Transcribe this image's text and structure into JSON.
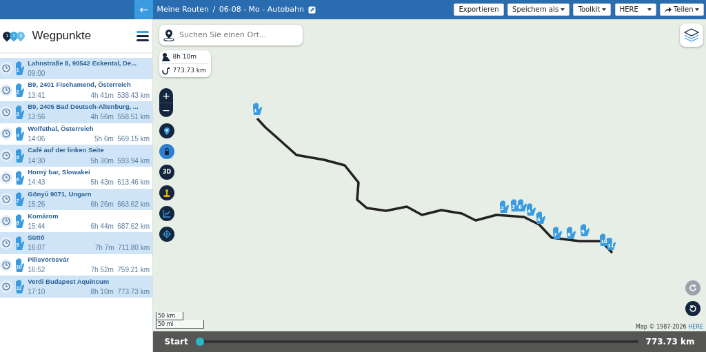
{
  "header": {
    "back": "←",
    "breadcrumb": "Meine Routen",
    "separator": "/",
    "route_name": "06-08 - Mo - Autobahn",
    "buttons": [
      {
        "label": "Exportieren",
        "kind": "plain"
      },
      {
        "label": "Speichern als",
        "kind": "dropdown"
      },
      {
        "label": "Toolkit",
        "kind": "dropdown"
      },
      {
        "label": "HERE",
        "kind": "select"
      },
      {
        "label": "Teilen",
        "kind": "share"
      }
    ]
  },
  "sidebar": {
    "logo_digits": [
      "1",
      "2",
      "3"
    ],
    "title": "Wegpunkte",
    "waypoints": [
      {
        "number": "1",
        "name": "Lahnstraße 8, 90542 Eckental, De...",
        "time": "09:00"
      },
      {
        "number": "2",
        "name": "B9, 2401 Fischamend, Österreich",
        "time": "13:41",
        "duration": "4h 41m",
        "distance": "538.43 km"
      },
      {
        "number": "3",
        "name": "B9, 2405 Bad Deutsch-Altenburg, ...",
        "time": "13:56",
        "duration": "4h 56m",
        "distance": "558.51 km"
      },
      {
        "number": "4",
        "name": "Wolfsthal, Österreich",
        "time": "14:06",
        "duration": "5h 6m",
        "distance": "569.15 km"
      },
      {
        "number": "5",
        "name": "Café auf der linken Seite",
        "time": "14:30",
        "duration": "5h 30m",
        "distance": "593.94 km"
      },
      {
        "number": "6",
        "name": "Horný bar, Slowakei",
        "time": "14:43",
        "duration": "5h 43m",
        "distance": "613.46 km"
      },
      {
        "number": "7",
        "name": "Gönyű 9071, Ungarn",
        "time": "15:26",
        "duration": "6h 26m",
        "distance": "663.62 km"
      },
      {
        "number": "8",
        "name": "Komárom",
        "time": "15:44",
        "duration": "6h 44m",
        "distance": "687.62 km"
      },
      {
        "number": "9",
        "name": "Süttő",
        "time": "16:07",
        "duration": "7h 7m",
        "distance": "711.80 km"
      },
      {
        "number": "10",
        "name": "Pilisvörösvár",
        "time": "16:52",
        "duration": "7h 52m",
        "distance": "759.21 km"
      },
      {
        "number": "11",
        "name": "Verdi Budapest Aquincum",
        "time": "17:10",
        "duration": "8h 10m",
        "distance": "773.73 km"
      }
    ]
  },
  "map": {
    "search": {
      "placeholder": "Suchen Sie einen Ort..."
    },
    "summary": {
      "duration": "8h 10m",
      "distance": "773.73 km"
    },
    "zoom_in": "+",
    "zoom_out": "−",
    "tools": [
      {
        "kind": "pin",
        "selected": false
      },
      {
        "kind": "lock",
        "selected": true
      },
      {
        "kind": "text",
        "label": "3D",
        "selected": false
      },
      {
        "kind": "person",
        "selected": false
      },
      {
        "kind": "chart",
        "selected": false
      },
      {
        "kind": "crosshair",
        "selected": false
      }
    ],
    "markers": [
      "1",
      "2",
      "3",
      "4",
      "5",
      "6",
      "7",
      "8",
      "9",
      "10",
      "11"
    ],
    "scale": [
      "50 km",
      "50 mi"
    ],
    "copyright": "Map © 1987-2026",
    "copyright_link": "HERE"
  },
  "playback": {
    "start": "Start",
    "level": 0,
    "total": "773.73 km"
  }
}
